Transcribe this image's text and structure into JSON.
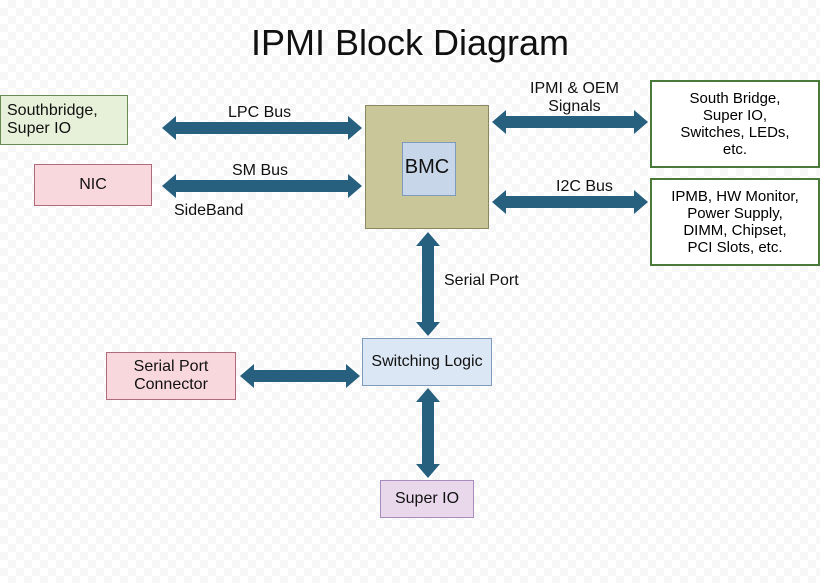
{
  "title": "IPMI Block Diagram",
  "blocks": {
    "southbridge_superio": "Southbridge,\nSuper IO",
    "nic": "NIC",
    "bmc": "BMC",
    "right_top": "South Bridge,\nSuper IO,\nSwitches, LEDs,\netc.",
    "right_bottom": "IPMB, HW Monitor,\nPower Supply,\nDIMM, Chipset,\nPCI Slots, etc.",
    "switching_logic": "Switching Logic",
    "serial_port_connector": "Serial Port\nConnector",
    "super_io": "Super IO"
  },
  "labels": {
    "lpc_bus": "LPC Bus",
    "sm_bus": "SM Bus",
    "sideband": "SideBand",
    "ipmi_oem_signals": "IPMI & OEM\nSignals",
    "i2c_bus": "I2C Bus",
    "serial_port": "Serial Port"
  }
}
